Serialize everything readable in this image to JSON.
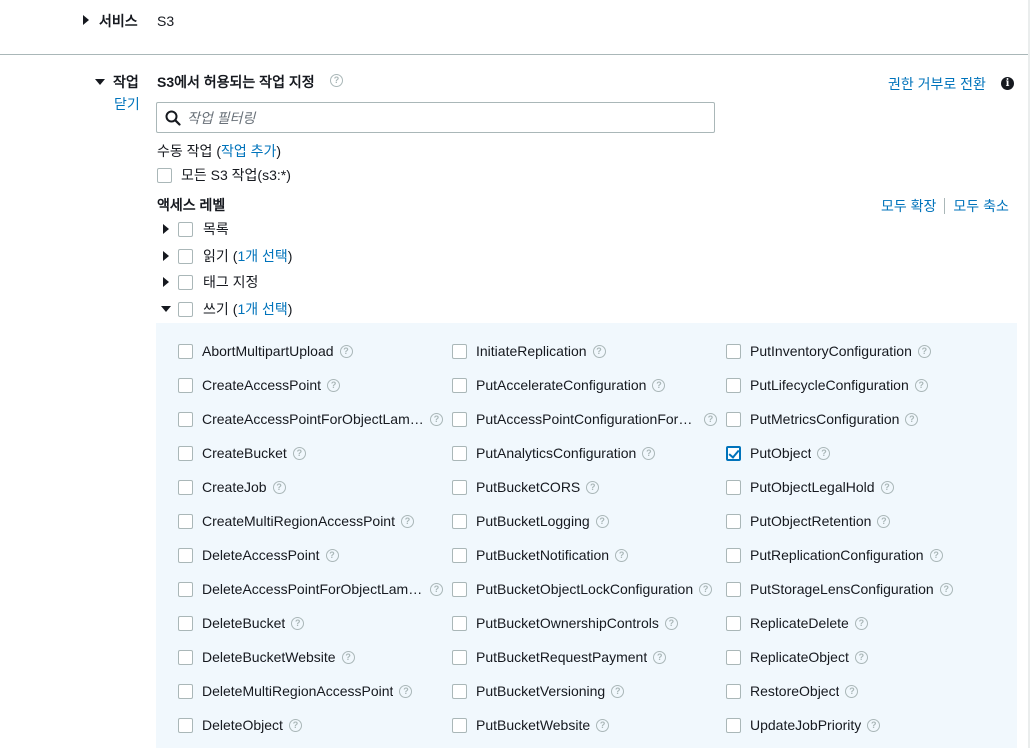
{
  "service": {
    "label": "서비스",
    "value": "S3"
  },
  "actions": {
    "label": "작업",
    "close": "닫기",
    "title": "S3에서 허용되는 작업 지정",
    "switch_link": "권한 거부로 전환",
    "filter_placeholder": "작업 필터링",
    "manual_label": "수동 작업",
    "manual_paren_open": "(",
    "manual_add": "작업 추가",
    "manual_paren_close": ")",
    "all_actions": "모든 S3 작업(s3:*)"
  },
  "access": {
    "title": "액세스 레벨",
    "expand_all": "모두 확장",
    "collapse_all": "모두 축소",
    "levels": [
      {
        "label": "목록",
        "selected": ""
      },
      {
        "label": "읽기",
        "selected": "1개 선택"
      },
      {
        "label": "태그 지정",
        "selected": ""
      },
      {
        "label": "쓰기",
        "selected": "1개 선택"
      }
    ]
  },
  "write_actions": {
    "col1": [
      "AbortMultipartUpload",
      "CreateAccessPoint",
      "CreateAccessPointForObjectLambda",
      "CreateBucket",
      "CreateJob",
      "CreateMultiRegionAccessPoint",
      "DeleteAccessPoint",
      "DeleteAccessPointForObjectLambda",
      "DeleteBucket",
      "DeleteBucketWebsite",
      "DeleteMultiRegionAccessPoint",
      "DeleteObject"
    ],
    "col2": [
      "InitiateReplication",
      "PutAccelerateConfiguration",
      "PutAccessPointConfigurationForObjectLambda",
      "PutAnalyticsConfiguration",
      "PutBucketCORS",
      "PutBucketLogging",
      "PutBucketNotification",
      "PutBucketObjectLockConfiguration",
      "PutBucketOwnershipControls",
      "PutBucketRequestPayment",
      "PutBucketVersioning",
      "PutBucketWebsite"
    ],
    "col3": [
      "PutInventoryConfiguration",
      "PutLifecycleConfiguration",
      "PutMetricsConfiguration",
      "PutObject",
      "PutObjectLegalHold",
      "PutObjectRetention",
      "PutReplicationConfiguration",
      "PutStorageLensConfiguration",
      "ReplicateDelete",
      "ReplicateObject",
      "RestoreObject",
      "UpdateJobPriority"
    ],
    "checked": [
      "PutObject"
    ]
  },
  "colors": {
    "link": "#0073bb",
    "panel": "#f1f8fd",
    "border": "#aab7b8"
  }
}
